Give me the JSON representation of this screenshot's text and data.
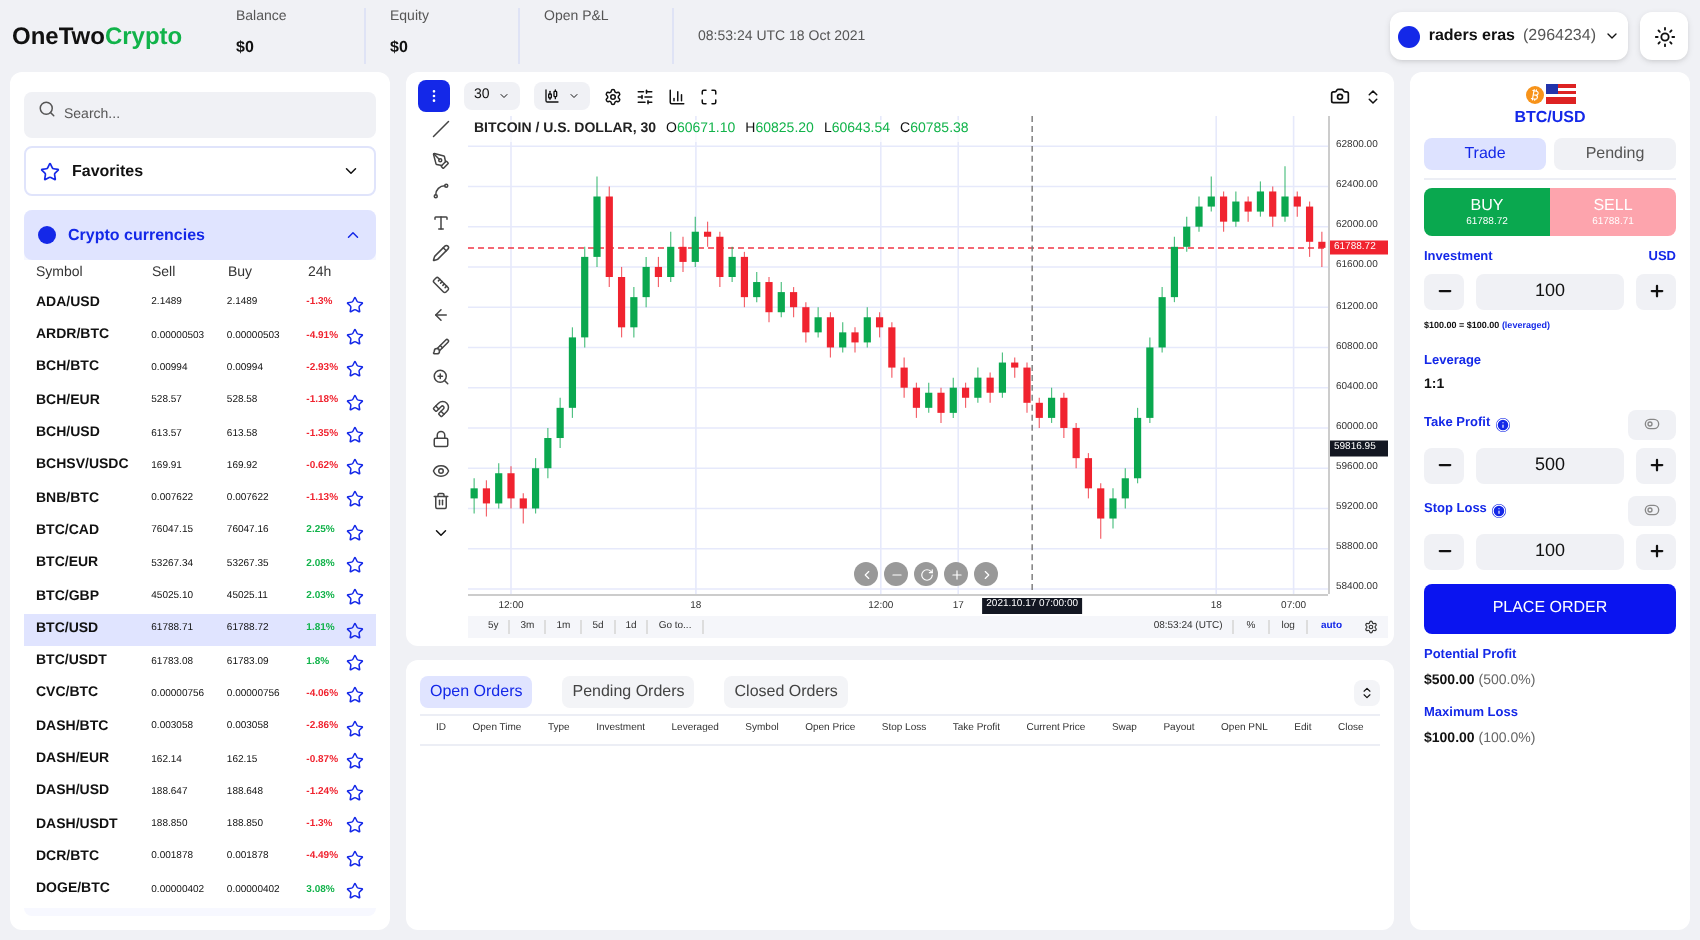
{
  "header": {
    "logo_part1": "OneTwo",
    "logo_part2": "Crypto",
    "stats": [
      {
        "label": "Balance",
        "value": "$0"
      },
      {
        "label": "Equity",
        "value": "$0"
      },
      {
        "label": "Open P&L"
      }
    ],
    "time": "08:53:24 UTC 18 Oct 2021",
    "user": {
      "name": "raders eras",
      "id": "(2964234)"
    }
  },
  "sidebar": {
    "search": {
      "placeholder": "Search..."
    },
    "sections": [
      {
        "title": "Favorites",
        "kind": "favorites",
        "expanded": false
      },
      {
        "title": "Crypto currencies",
        "kind": "crypto",
        "expanded": true
      }
    ],
    "columns": [
      "Symbol",
      "Sell",
      "Buy",
      "24h"
    ],
    "rows": [
      {
        "symbol": "ADA/USD",
        "sell": "2.1489",
        "buy": "2.1489",
        "change": "-1.3%",
        "color": "#f0232f",
        "selected": false
      },
      {
        "symbol": "ARDR/BTC",
        "sell": "0.00000503",
        "buy": "0.00000503",
        "change": "-4.91%",
        "color": "#f0232f",
        "selected": false
      },
      {
        "symbol": "BCH/BTC",
        "sell": "0.00994",
        "buy": "0.00994",
        "change": "-2.93%",
        "color": "#f0232f",
        "selected": false
      },
      {
        "symbol": "BCH/EUR",
        "sell": "528.57",
        "buy": "528.58",
        "change": "-1.18%",
        "color": "#f0232f",
        "selected": false
      },
      {
        "symbol": "BCH/USD",
        "sell": "613.57",
        "buy": "613.58",
        "change": "-1.35%",
        "color": "#f0232f",
        "selected": false
      },
      {
        "symbol": "BCHSV/USDC",
        "sell": "169.91",
        "buy": "169.92",
        "change": "-0.62%",
        "color": "#f0232f",
        "selected": false
      },
      {
        "symbol": "BNB/BTC",
        "sell": "0.007622",
        "buy": "0.007622",
        "change": "-1.13%",
        "color": "#f0232f",
        "selected": false
      },
      {
        "symbol": "BTC/CAD",
        "sell": "76047.15",
        "buy": "76047.16",
        "change": "2.25%",
        "color": "#11b34a",
        "selected": false
      },
      {
        "symbol": "BTC/EUR",
        "sell": "53267.34",
        "buy": "53267.35",
        "change": "2.08%",
        "color": "#11b34a",
        "selected": false
      },
      {
        "symbol": "BTC/GBP",
        "sell": "45025.10",
        "buy": "45025.11",
        "change": "2.03%",
        "color": "#11b34a",
        "selected": false
      },
      {
        "symbol": "BTC/USD",
        "sell": "61788.71",
        "buy": "61788.72",
        "change": "1.81%",
        "color": "#11b34a",
        "selected": true
      },
      {
        "symbol": "BTC/USDT",
        "sell": "61783.08",
        "buy": "61783.09",
        "change": "1.8%",
        "color": "#11b34a",
        "selected": false
      },
      {
        "symbol": "CVC/BTC",
        "sell": "0.00000756",
        "buy": "0.00000756",
        "change": "-4.06%",
        "color": "#f0232f",
        "selected": false
      },
      {
        "symbol": "DASH/BTC",
        "sell": "0.003058",
        "buy": "0.003058",
        "change": "-2.86%",
        "color": "#f0232f",
        "selected": false
      },
      {
        "symbol": "DASH/EUR",
        "sell": "162.14",
        "buy": "162.15",
        "change": "-0.87%",
        "color": "#f0232f",
        "selected": false
      },
      {
        "symbol": "DASH/USD",
        "sell": "188.647",
        "buy": "188.648",
        "change": "-1.24%",
        "color": "#f0232f",
        "selected": false
      },
      {
        "symbol": "DASH/USDT",
        "sell": "188.850",
        "buy": "188.850",
        "change": "-1.3%",
        "color": "#f0232f",
        "selected": false
      },
      {
        "symbol": "DCR/BTC",
        "sell": "0.001878",
        "buy": "0.001878",
        "change": "-4.49%",
        "color": "#f0232f",
        "selected": false
      },
      {
        "symbol": "DOGE/BTC",
        "sell": "0.00000402",
        "buy": "0.00000402",
        "change": "3.08%",
        "color": "#11b34a",
        "selected": false
      }
    ]
  },
  "chart": {
    "interval": "30",
    "legend": {
      "title": "BITCOIN / U.S. DOLLAR, 30",
      "values": [
        {
          "key": "O",
          "value": "60671.10"
        },
        {
          "key": "H",
          "value": "60825.20"
        },
        {
          "key": "L",
          "value": "60643.54"
        },
        {
          "key": "C",
          "value": "60785.38"
        }
      ]
    },
    "current_price": "61788.72",
    "crosshair_price": "59816.95",
    "crosshair_time": "2021.10.17 07:00:00",
    "ranges": [
      "5y",
      "3m",
      "1m",
      "5d",
      "1d",
      "Go to..."
    ],
    "clock": "08:53:24 (UTC)",
    "scale_options": [
      {
        "label": "%",
        "selected": false
      },
      {
        "label": "log",
        "selected": false
      },
      {
        "label": "auto",
        "selected": true
      }
    ],
    "time_labels": [
      "12:00",
      "18",
      "12:00",
      "17",
      "18",
      "07:00"
    ],
    "chart_data": {
      "type": "candlestick",
      "ylim": [
        58350,
        63100
      ],
      "grid": true,
      "ref_lines": [
        {
          "axis": "y",
          "value": 61788.72,
          "color": "#f23645"
        }
      ],
      "yticks": [
        {
          "value": 62800,
          "label": "62800.00"
        },
        {
          "value": 62400,
          "label": "62400.00"
        },
        {
          "value": 62000,
          "label": "62000.00"
        },
        {
          "value": 61600,
          "label": "61600.00"
        },
        {
          "value": 61200,
          "label": "61200.00"
        },
        {
          "value": 60800,
          "label": "60800.00"
        },
        {
          "value": 60400,
          "label": "60400.00"
        },
        {
          "value": 60000,
          "label": "60000.00"
        },
        {
          "value": 59600,
          "label": "59600.00"
        },
        {
          "value": 59200,
          "label": "59200.00"
        },
        {
          "value": 58800,
          "label": "58800.00"
        },
        {
          "value": 58400,
          "label": "58400.00"
        }
      ],
      "categories": [
        null,
        null,
        null,
        null,
        null,
        null,
        null,
        null,
        null,
        null,
        null,
        null,
        null,
        null,
        null,
        null,
        null,
        null,
        null,
        null,
        null,
        null,
        null,
        null,
        null,
        null,
        null,
        null,
        null,
        null,
        null,
        null,
        null,
        null,
        null,
        null,
        null,
        null,
        null,
        null,
        null,
        null,
        null,
        null,
        null,
        null,
        null,
        null,
        null,
        null,
        null,
        null,
        null,
        null,
        null,
        null,
        null,
        null,
        null,
        null,
        null,
        null,
        null,
        null,
        null,
        null,
        null,
        null,
        null,
        null
      ],
      "ohlc": [
        [
          59300,
          59500,
          59150,
          59400
        ],
        [
          59400,
          59480,
          59120,
          59250
        ],
        [
          59250,
          59650,
          59200,
          59550
        ],
        [
          59550,
          59620,
          59200,
          59300
        ],
        [
          59300,
          59350,
          59050,
          59200
        ],
        [
          59200,
          59700,
          59150,
          59600
        ],
        [
          59600,
          60000,
          59500,
          59900
        ],
        [
          59900,
          60300,
          59800,
          60200
        ],
        [
          60200,
          61000,
          60100,
          60900
        ],
        [
          60900,
          61800,
          60800,
          61700
        ],
        [
          61700,
          62500,
          61600,
          62300
        ],
        [
          62300,
          62400,
          61400,
          61500
        ],
        [
          61500,
          61600,
          60900,
          61000
        ],
        [
          61000,
          61400,
          60900,
          61300
        ],
        [
          61300,
          61700,
          61200,
          61600
        ],
        [
          61600,
          61700,
          61400,
          61500
        ],
        [
          61500,
          61950,
          61450,
          61800
        ],
        [
          61800,
          61900,
          61550,
          61650
        ],
        [
          61650,
          62100,
          61600,
          61950
        ],
        [
          61950,
          62050,
          61800,
          61900
        ],
        [
          61900,
          61950,
          61400,
          61500
        ],
        [
          61500,
          61800,
          61450,
          61700
        ],
        [
          61700,
          61750,
          61200,
          61300
        ],
        [
          61300,
          61550,
          61250,
          61450
        ],
        [
          61450,
          61500,
          61050,
          61150
        ],
        [
          61150,
          61450,
          61100,
          61350
        ],
        [
          61350,
          61400,
          61100,
          61200
        ],
        [
          61200,
          61250,
          60850,
          60950
        ],
        [
          60950,
          61200,
          60900,
          61100
        ],
        [
          61100,
          61150,
          60700,
          60800
        ],
        [
          60800,
          61050,
          60750,
          60950
        ],
        [
          60950,
          61000,
          60750,
          60850
        ],
        [
          60850,
          61200,
          60800,
          61100
        ],
        [
          61100,
          61150,
          60900,
          61000
        ],
        [
          61000,
          61050,
          60500,
          60600
        ],
        [
          60600,
          60700,
          60300,
          60400
        ],
        [
          60400,
          60450,
          60100,
          60200
        ],
        [
          60200,
          60450,
          60150,
          60350
        ],
        [
          60350,
          60400,
          60050,
          60150
        ],
        [
          60150,
          60500,
          60100,
          60400
        ],
        [
          60400,
          60450,
          60200,
          60300
        ],
        [
          60300,
          60600,
          60250,
          60500
        ],
        [
          60500,
          60550,
          60250,
          60350
        ],
        [
          60350,
          60750,
          60300,
          60650
        ],
        [
          60650,
          60700,
          60500,
          60600
        ],
        [
          60600,
          60650,
          60150,
          60250
        ],
        [
          60250,
          60300,
          60000,
          60100
        ],
        [
          60100,
          60400,
          60050,
          60300
        ],
        [
          60300,
          60350,
          59900,
          60000
        ],
        [
          60000,
          60050,
          59600,
          59700
        ],
        [
          59700,
          59750,
          59300,
          59400
        ],
        [
          59400,
          59450,
          58900,
          59100
        ],
        [
          59100,
          59400,
          59000,
          59300
        ],
        [
          59300,
          59600,
          59200,
          59500
        ],
        [
          59500,
          60200,
          59450,
          60100
        ],
        [
          60100,
          60900,
          60050,
          60800
        ],
        [
          60800,
          61400,
          60750,
          61300
        ],
        [
          61300,
          61900,
          61250,
          61800
        ],
        [
          61800,
          62100,
          61750,
          62000
        ],
        [
          62000,
          62300,
          61950,
          62200
        ],
        [
          62200,
          62500,
          62150,
          62300
        ],
        [
          62300,
          62350,
          61950,
          62050
        ],
        [
          62050,
          62350,
          62000,
          62250
        ],
        [
          62250,
          62300,
          62050,
          62150
        ],
        [
          62150,
          62450,
          62100,
          62350
        ],
        [
          62350,
          62400,
          62000,
          62100
        ],
        [
          62100,
          62600,
          62050,
          62300
        ],
        [
          62300,
          62350,
          62100,
          62200
        ],
        [
          62200,
          62250,
          61700,
          61850
        ],
        [
          61850,
          61950,
          61600,
          61790
        ]
      ]
    }
  },
  "orders": {
    "tabs": [
      {
        "label": "Open Orders",
        "selected": true
      },
      {
        "label": "Pending Orders",
        "selected": false
      },
      {
        "label": "Closed Orders",
        "selected": false
      }
    ],
    "columns": [
      "ID",
      "Open Time",
      "Type",
      "Investment",
      "Leveraged",
      "Symbol",
      "Open Price",
      "Stop Loss",
      "Take Profit",
      "Current Price",
      "Swap",
      "Payout",
      "Open PNL",
      "Edit",
      "Close"
    ]
  },
  "trade_panel": {
    "symbol": "BTC/USD",
    "tabs": [
      {
        "label": "Trade",
        "selected": true
      },
      {
        "label": "Pending",
        "selected": false
      }
    ],
    "sides": [
      {
        "label": "BUY",
        "price": "61788.72",
        "selected": true
      },
      {
        "label": "SELL",
        "price": "61788.71",
        "selected": false
      }
    ],
    "investment": {
      "label": "Investment",
      "currency": "USD",
      "value": "100"
    },
    "leveraged_note": "$100.00 = $100.00",
    "leveraged_tag": "(leveraged)",
    "leverage": {
      "label": "Leverage",
      "value": "1:1"
    },
    "take_profit": {
      "label": "Take Profit",
      "value": "500"
    },
    "stop_loss": {
      "label": "Stop Loss",
      "value": "100"
    },
    "place_order": "PLACE ORDER",
    "potential_profit": {
      "label": "Potential Profit",
      "value": "$500.00",
      "percent": "(500.0%)"
    },
    "maximum_loss": {
      "label": "Maximum Loss",
      "value": "$100.00",
      "percent": "(100.0%)"
    }
  }
}
